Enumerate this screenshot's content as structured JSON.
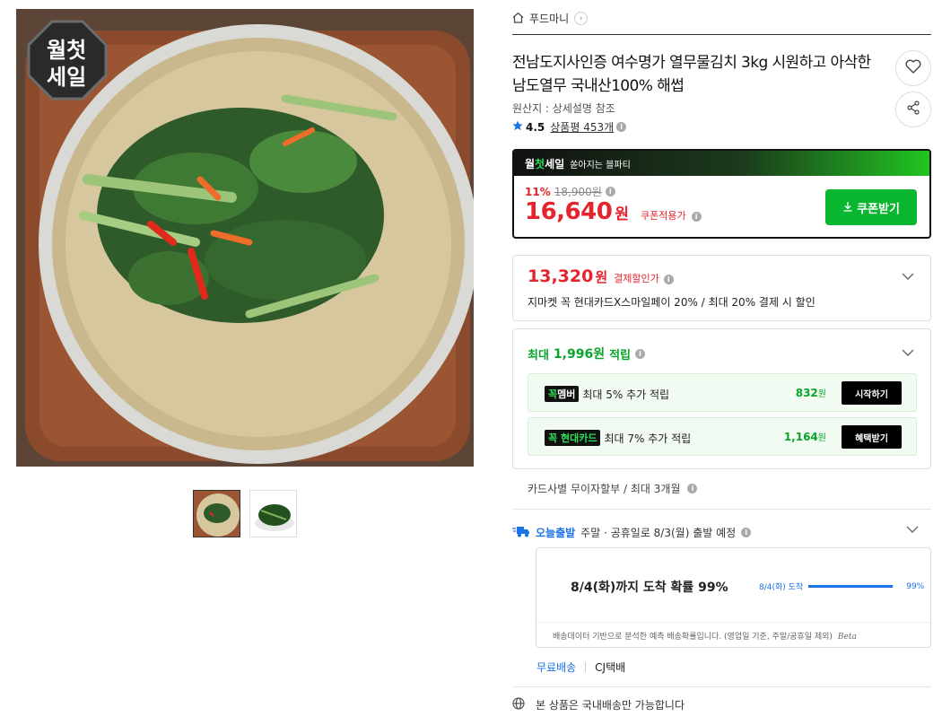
{
  "gallery": {
    "badge_line1": "월첫",
    "badge_line2": "세일"
  },
  "breadcrumb": {
    "shop": "푸드마니"
  },
  "product": {
    "title": "전남도지사인증 여수명가 열무물김치 3kg 시원하고 아삭한 남도열무 국내산100% 해썹",
    "origin": "원산지 : 상세설명 참조",
    "rating": "4.5",
    "reviews": "상품평 453개"
  },
  "coupon": {
    "banner_logo_a": "월",
    "banner_logo_b": "첫",
    "banner_logo_c": "세일",
    "banner_sub": "쏟아지는 블파티",
    "discount_rate": "11%",
    "original_price": "18,900원",
    "sale_price": "16,640",
    "sale_unit": "원",
    "sale_label": "쿠폰적용가",
    "button": "쿠폰받기"
  },
  "card_discount": {
    "price": "13,320",
    "unit": "원",
    "label": "결제할인가",
    "desc": "지마켓 꼭 현대카드X스마일페이 20% / 최대 20% 결제 시 할인"
  },
  "points": {
    "prefix": "최대",
    "amount": "1,996원",
    "suffix": "적립",
    "items": [
      {
        "tag_a": "꼭",
        "tag_b": "멤버",
        "text": "최대 5% 추가 적립",
        "amount": "832",
        "unit": "원",
        "button": "시작하기"
      },
      {
        "tag_a": "꼭",
        "tag_b": "현대카드",
        "text": "최대 7% 추가 적립",
        "amount": "1,164",
        "unit": "원",
        "button": "혜택받기"
      }
    ]
  },
  "installment": "카드사별 무이자할부 / 최대 3개월",
  "delivery": {
    "brand": "오늘출발",
    "schedule": "주말 · 공휴일로 8/3(월) 출발 예정",
    "main": "8/4(화)까지 도착 확률 99%",
    "bar_label": "8/4(화) 도착",
    "bar_percent_text": "99%",
    "bar_fraction": 0.99,
    "note": "배송데이터 기반으로 분석한 예측 배송확률입니다. (영업일 기준, 주말/공휴일 제외)",
    "beta": "Beta",
    "free": "무료배송",
    "carrier": "CJ택배"
  },
  "domestic_note": "본 상품은 국내배송만 가능합니다",
  "colors": {
    "sale_red": "#e5232d",
    "green": "#0ab530",
    "blue": "#1a73e8"
  },
  "icons": [
    "home-icon",
    "chevron-right-icon",
    "heart-icon",
    "share-icon",
    "star-icon",
    "info-icon",
    "download-icon",
    "chevron-down-icon",
    "truck-icon",
    "globe-icon"
  ]
}
